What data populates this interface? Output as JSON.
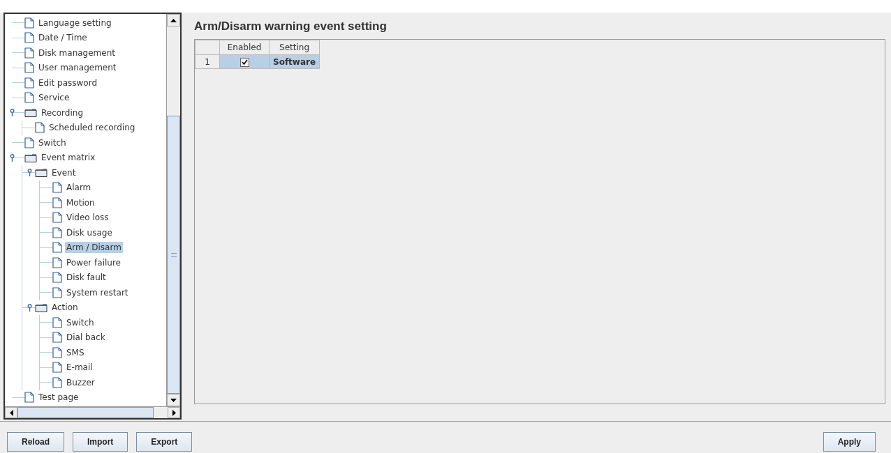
{
  "tree": {
    "items": [
      {
        "label": "Language setting",
        "kind": "page",
        "selected": false
      },
      {
        "label": "Date / Time",
        "kind": "page",
        "selected": false
      },
      {
        "label": "Disk management",
        "kind": "page",
        "selected": false
      },
      {
        "label": "User management",
        "kind": "page",
        "selected": false
      },
      {
        "label": "Edit password",
        "kind": "page",
        "selected": false
      },
      {
        "label": "Service",
        "kind": "page",
        "selected": false
      },
      {
        "label": "Recording",
        "kind": "folder",
        "selected": false,
        "expanded": true,
        "children": [
          {
            "label": "Scheduled recording",
            "kind": "page",
            "selected": false
          }
        ]
      },
      {
        "label": "Switch",
        "kind": "page",
        "selected": false
      },
      {
        "label": "Event matrix",
        "kind": "folder",
        "selected": false,
        "expanded": true,
        "children": [
          {
            "label": "Event",
            "kind": "folder",
            "selected": false,
            "expanded": true,
            "children": [
              {
                "label": "Alarm",
                "kind": "page",
                "selected": false
              },
              {
                "label": "Motion",
                "kind": "page",
                "selected": false
              },
              {
                "label": "Video loss",
                "kind": "page",
                "selected": false
              },
              {
                "label": "Disk usage",
                "kind": "page",
                "selected": false
              },
              {
                "label": "Arm / Disarm",
                "kind": "page",
                "selected": true
              },
              {
                "label": "Power failure",
                "kind": "page",
                "selected": false
              },
              {
                "label": "Disk fault",
                "kind": "page",
                "selected": false
              },
              {
                "label": "System restart",
                "kind": "page",
                "selected": false
              }
            ]
          },
          {
            "label": "Action",
            "kind": "folder",
            "selected": false,
            "expanded": true,
            "children": [
              {
                "label": "Switch",
                "kind": "page",
                "selected": false
              },
              {
                "label": "Dial back",
                "kind": "page",
                "selected": false
              },
              {
                "label": "SMS",
                "kind": "page",
                "selected": false
              },
              {
                "label": "E-mail",
                "kind": "page",
                "selected": false
              },
              {
                "label": "Buzzer",
                "kind": "page",
                "selected": false
              }
            ]
          }
        ]
      },
      {
        "label": "Test page",
        "kind": "page",
        "selected": false
      }
    ]
  },
  "content": {
    "title": "Arm/Disarm warning event setting",
    "table": {
      "columns": [
        "Enabled",
        "Setting"
      ],
      "rows": [
        {
          "number": "1",
          "enabled": true,
          "setting": "Software",
          "selected": true
        }
      ]
    }
  },
  "buttons": [
    {
      "label": "Reload"
    },
    {
      "label": "Import"
    },
    {
      "label": "Export"
    }
  ],
  "apply_button": {
    "label": "Apply"
  }
}
